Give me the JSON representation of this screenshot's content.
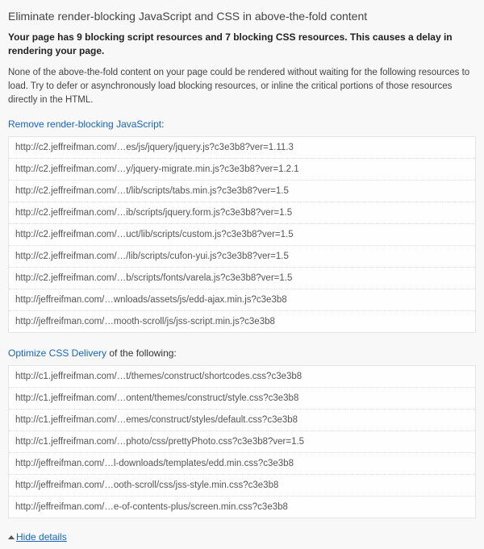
{
  "title": "Eliminate render-blocking JavaScript and CSS in above-the-fold content",
  "summary": "Your page has 9 blocking script resources and 7 blocking CSS resources. This causes a delay in rendering your page.",
  "description": "None of the above-the-fold content on your page could be rendered without waiting for the following resources to load. Try to defer or asynchronously load blocking resources, or inline the critical portions of those resources directly in the HTML.",
  "js_section": {
    "link": "Remove render-blocking JavaScript",
    "tail": ":"
  },
  "js_items": [
    "http://c2.jeffreifman.com/…es/js/jquery/jquery.js?c3e3b8?ver=1.11.3",
    "http://c2.jeffreifman.com/…y/jquery-migrate.min.js?c3e3b8?ver=1.2.1",
    "http://c2.jeffreifman.com/…t/lib/scripts/tabs.min.js?c3e3b8?ver=1.5",
    "http://c2.jeffreifman.com/…ib/scripts/jquery.form.js?c3e3b8?ver=1.5",
    "http://c2.jeffreifman.com/…uct/lib/scripts/custom.js?c3e3b8?ver=1.5",
    "http://c2.jeffreifman.com/…/lib/scripts/cufon-yui.js?c3e3b8?ver=1.5",
    "http://c2.jeffreifman.com/…b/scripts/fonts/varela.js?c3e3b8?ver=1.5",
    "http://jeffreifman.com/…wnloads/assets/js/edd-ajax.min.js?c3e3b8",
    "http://jeffreifman.com/…mooth-scroll/js/jss-script.min.js?c3e3b8"
  ],
  "css_section": {
    "link": "Optimize CSS Delivery",
    "tail": " of the following:"
  },
  "css_items": [
    "http://c1.jeffreifman.com/…t/themes/construct/shortcodes.css?c3e3b8",
    "http://c1.jeffreifman.com/…ontent/themes/construct/style.css?c3e3b8",
    "http://c1.jeffreifman.com/…emes/construct/styles/default.css?c3e3b8",
    "http://c1.jeffreifman.com/…photo/css/prettyPhoto.css?c3e3b8?ver=1.5",
    "http://jeffreifman.com/…l-downloads/templates/edd.min.css?c3e3b8",
    "http://jeffreifman.com/…ooth-scroll/css/jss-style.min.css?c3e3b8",
    "http://jeffreifman.com/…e-of-contents-plus/screen.min.css?c3e3b8"
  ],
  "hide_details": "Hide details"
}
